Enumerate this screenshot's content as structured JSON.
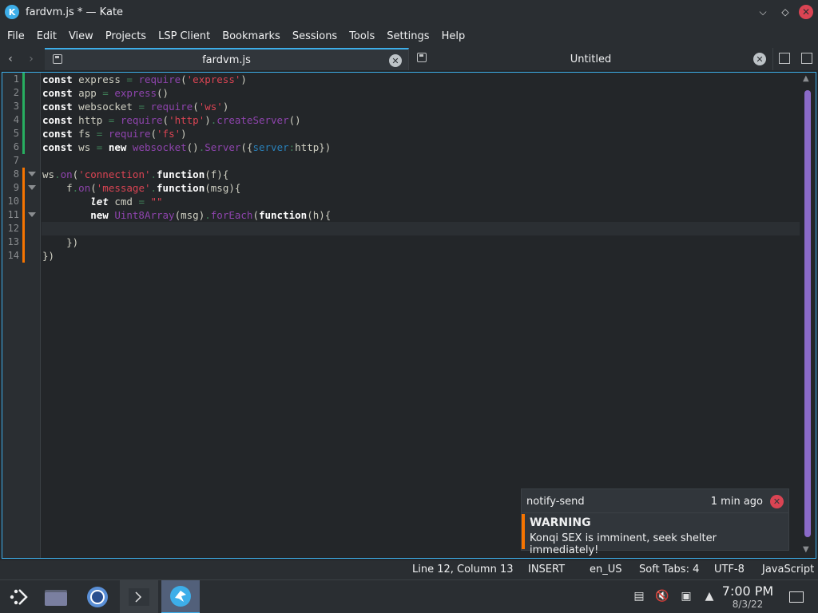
{
  "window": {
    "title": "fardvm.js * — Kate",
    "controls": {
      "minimize": "⌵",
      "maximize": "◇",
      "close": "✕"
    }
  },
  "menu": [
    "File",
    "Edit",
    "View",
    "Projects",
    "LSP Client",
    "Bookmarks",
    "Sessions",
    "Tools",
    "Settings",
    "Help"
  ],
  "tabs": [
    {
      "label": "fardvm.js",
      "active": true
    },
    {
      "label": "Untitled",
      "active": false
    }
  ],
  "editor": {
    "line_numbers": [
      "1",
      "2",
      "3",
      "4",
      "5",
      "6",
      "7",
      "8",
      "9",
      "10",
      "11",
      "12",
      "13",
      "14"
    ],
    "current_line": 12,
    "lines": [
      [
        [
          "kw",
          "const"
        ],
        [
          "t",
          " express "
        ],
        [
          "op",
          "="
        ],
        [
          "t",
          " "
        ],
        [
          "fn",
          "require"
        ],
        [
          "t",
          "("
        ],
        [
          "str",
          "'express'"
        ],
        [
          "t",
          ")"
        ]
      ],
      [
        [
          "kw",
          "const"
        ],
        [
          "t",
          " app "
        ],
        [
          "op",
          "="
        ],
        [
          "t",
          " "
        ],
        [
          "fn",
          "express"
        ],
        [
          "t",
          "()"
        ]
      ],
      [
        [
          "kw",
          "const"
        ],
        [
          "t",
          " websocket "
        ],
        [
          "op",
          "="
        ],
        [
          "t",
          " "
        ],
        [
          "fn",
          "require"
        ],
        [
          "t",
          "("
        ],
        [
          "str",
          "'ws'"
        ],
        [
          "t",
          ")"
        ]
      ],
      [
        [
          "kw",
          "const"
        ],
        [
          "t",
          " http "
        ],
        [
          "op",
          "="
        ],
        [
          "t",
          " "
        ],
        [
          "fn",
          "require"
        ],
        [
          "t",
          "("
        ],
        [
          "str",
          "'http'"
        ],
        [
          "t",
          ")"
        ],
        [
          "op",
          "."
        ],
        [
          "fn",
          "createServer"
        ],
        [
          "t",
          "()"
        ]
      ],
      [
        [
          "kw",
          "const"
        ],
        [
          "t",
          " fs "
        ],
        [
          "op",
          "="
        ],
        [
          "t",
          " "
        ],
        [
          "fn",
          "require"
        ],
        [
          "t",
          "("
        ],
        [
          "str",
          "'fs'"
        ],
        [
          "t",
          ")"
        ]
      ],
      [
        [
          "kw",
          "const"
        ],
        [
          "t",
          " ws "
        ],
        [
          "op",
          "="
        ],
        [
          "t",
          " "
        ],
        [
          "kw",
          "new"
        ],
        [
          "t",
          " "
        ],
        [
          "fn",
          "websocket"
        ],
        [
          "t",
          "()"
        ],
        [
          "op",
          "."
        ],
        [
          "fn",
          "Server"
        ],
        [
          "t",
          "({"
        ],
        [
          "prop",
          "server"
        ],
        [
          "op",
          ":"
        ],
        [
          "t",
          "http})"
        ]
      ],
      [],
      [
        [
          "t",
          "ws"
        ],
        [
          "op",
          "."
        ],
        [
          "fn",
          "on"
        ],
        [
          "t",
          "("
        ],
        [
          "str",
          "'connection'"
        ],
        [
          "op",
          "."
        ],
        [
          "kw",
          "function"
        ],
        [
          "t",
          "(f){"
        ]
      ],
      [
        [
          "t",
          "    f"
        ],
        [
          "op",
          "."
        ],
        [
          "fn",
          "on"
        ],
        [
          "t",
          "("
        ],
        [
          "str",
          "'message'"
        ],
        [
          "op",
          "."
        ],
        [
          "kw",
          "function"
        ],
        [
          "t",
          "(msg){"
        ]
      ],
      [
        [
          "t",
          "        "
        ],
        [
          "kwi",
          "let"
        ],
        [
          "t",
          " cmd "
        ],
        [
          "op",
          "="
        ],
        [
          "t",
          " "
        ],
        [
          "str",
          "\"\""
        ]
      ],
      [
        [
          "t",
          "        "
        ],
        [
          "kw",
          "new"
        ],
        [
          "t",
          " "
        ],
        [
          "fn",
          "Uint8Array"
        ],
        [
          "t",
          "(msg)"
        ],
        [
          "op",
          "."
        ],
        [
          "fn",
          "forEach"
        ],
        [
          "t",
          "("
        ],
        [
          "kw",
          "function"
        ],
        [
          "t",
          "(h){"
        ]
      ],
      [],
      [
        [
          "t",
          "    })"
        ]
      ],
      [
        [
          "t",
          "})"
        ]
      ]
    ]
  },
  "notification": {
    "app": "notify-send",
    "time": "1 min ago",
    "title": "WARNING",
    "body": "Konqi SEX is imminent, seek shelter immediately!"
  },
  "status": {
    "position": "Line 12, Column 13",
    "mode": "INSERT",
    "language_dict": "en_US",
    "indent": "Soft Tabs: 4",
    "encoding": "UTF-8",
    "syntax": "JavaScript"
  },
  "taskbar": {
    "clock_time": "7:00 PM",
    "clock_date": "8/3/22"
  },
  "colors": {
    "accent": "#3daee9",
    "warning": "#f67400",
    "close": "#da4453",
    "modified_saved": "#27ae60",
    "modified_unsaved": "#f67400"
  }
}
